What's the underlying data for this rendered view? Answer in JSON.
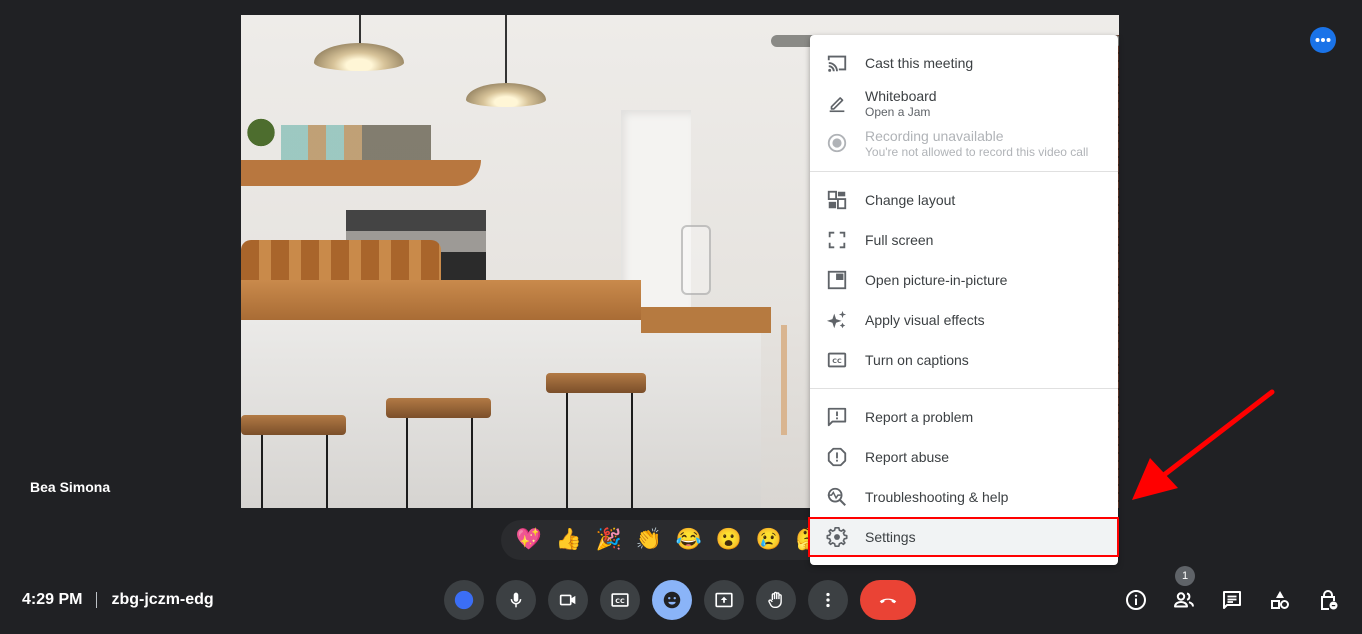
{
  "participant": {
    "name": "Bea Simona"
  },
  "meeting": {
    "time": "4:29 PM",
    "code": "zbg-jczm-edg"
  },
  "top_right": {
    "more_icon": "more-horiz-icon"
  },
  "reactions": [
    {
      "emoji": "💖",
      "name": "sparkling-heart"
    },
    {
      "emoji": "👍",
      "name": "thumbs-up"
    },
    {
      "emoji": "🎉",
      "name": "party-popper"
    },
    {
      "emoji": "👏",
      "name": "clapping-hands"
    },
    {
      "emoji": "😂",
      "name": "tears-of-joy"
    },
    {
      "emoji": "😮",
      "name": "surprised"
    },
    {
      "emoji": "😢",
      "name": "crying"
    },
    {
      "emoji": "🤔",
      "name": "thinking"
    }
  ],
  "controls": [
    {
      "name": "avatar-dot",
      "icon": "blue-dot-icon"
    },
    {
      "name": "microphone",
      "icon": "mic-icon"
    },
    {
      "name": "camera",
      "icon": "videocam-icon"
    },
    {
      "name": "captions",
      "icon": "closed-caption-icon"
    },
    {
      "name": "reactions",
      "icon": "emoji-icon",
      "active": true
    },
    {
      "name": "present",
      "icon": "present-screen-icon"
    },
    {
      "name": "raise-hand",
      "icon": "hand-icon"
    },
    {
      "name": "more-options",
      "icon": "more-vert-icon"
    },
    {
      "name": "leave-call",
      "icon": "call-end-icon"
    }
  ],
  "side_controls": {
    "info": "info-icon",
    "people": "people-icon",
    "people_count": "1",
    "chat": "chat-icon",
    "activities": "shapes-icon",
    "host_controls": "lock-person-icon"
  },
  "menu": {
    "sections": [
      [
        {
          "label": "Cast this meeting",
          "icon": "cast-icon"
        },
        {
          "label": "Whiteboard",
          "sub": "Open a Jam",
          "icon": "pen-icon"
        },
        {
          "label": "Recording unavailable",
          "sub": "You're not allowed to record this video call",
          "icon": "record-icon",
          "disabled": true
        }
      ],
      [
        {
          "label": "Change layout",
          "icon": "layout-icon"
        },
        {
          "label": "Full screen",
          "icon": "fullscreen-icon"
        },
        {
          "label": "Open picture-in-picture",
          "icon": "pip-icon"
        },
        {
          "label": "Apply visual effects",
          "icon": "sparkle-icon"
        },
        {
          "label": "Turn on captions",
          "icon": "closed-caption-icon"
        }
      ],
      [
        {
          "label": "Report a problem",
          "icon": "feedback-icon"
        },
        {
          "label": "Report abuse",
          "icon": "report-icon"
        },
        {
          "label": "Troubleshooting & help",
          "icon": "troubleshoot-icon"
        },
        {
          "label": "Settings",
          "icon": "settings-icon",
          "highlighted": true
        }
      ]
    ]
  },
  "colors": {
    "background": "#202124",
    "control": "#3c4043",
    "active_control": "#8ab4f8",
    "end_call": "#ea4335",
    "accent_blue": "#1a73e8",
    "annotation_red": "#ff0000"
  }
}
